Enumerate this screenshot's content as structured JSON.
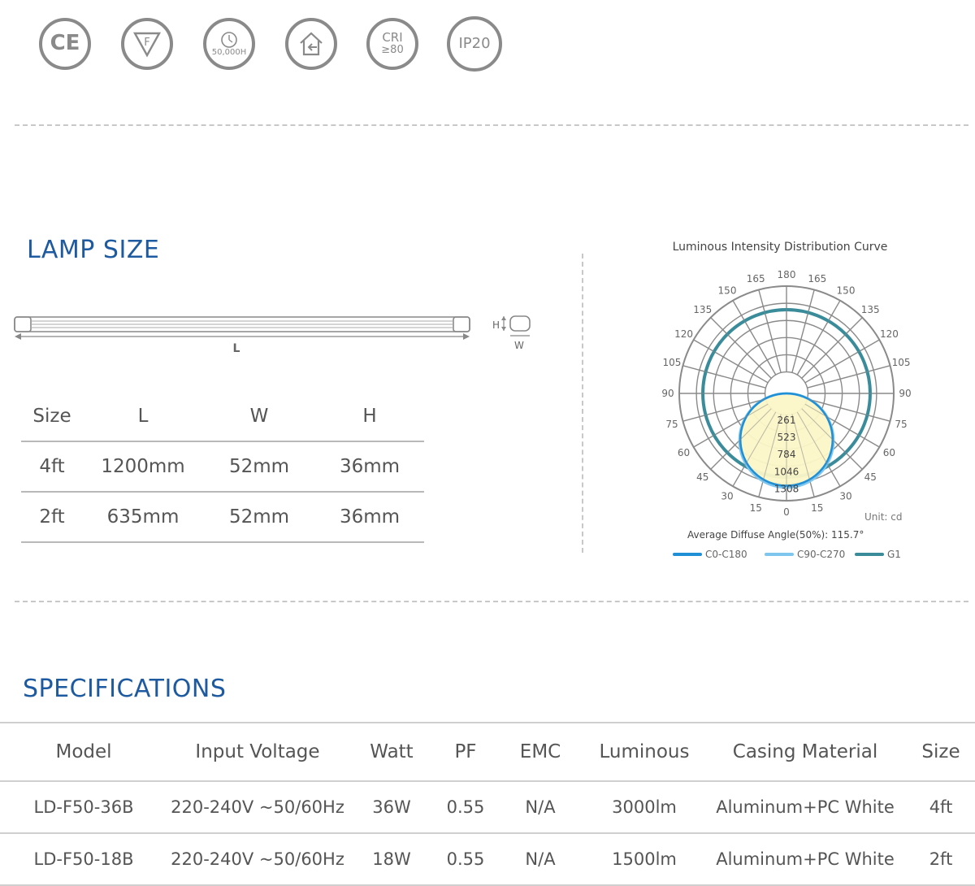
{
  "badges": [
    {
      "icon": "ce-mark-icon",
      "label": "CE"
    },
    {
      "icon": "f-mark-icon",
      "label": "F"
    },
    {
      "icon": "lifetime-clock-icon",
      "label": "50,000H"
    },
    {
      "icon": "indoor-use-icon",
      "label": ""
    },
    {
      "icon": "cri-icon",
      "label": "CRI",
      "sub": "≥80"
    },
    {
      "icon": "ip-rating-icon",
      "label": "IP20"
    }
  ],
  "lamp_size": {
    "title": "LAMP SIZE",
    "dim_labels": {
      "length": "L",
      "height": "H",
      "width": "W"
    },
    "headers": [
      "Size",
      "L",
      "W",
      "H"
    ],
    "rows": [
      [
        "4ft",
        "1200mm",
        "52mm",
        "36mm"
      ],
      [
        "2ft",
        "635mm",
        "52mm",
        "36mm"
      ]
    ]
  },
  "chart_data": {
    "type": "polar",
    "title": "Luminous Intensity Distribution Curve",
    "unit": "Unit: cd",
    "note": "Average Diffuse Angle(50%): 115.7°",
    "angle_labels": [
      "180",
      "165",
      "150",
      "135",
      "120",
      "105",
      "90",
      "75",
      "60",
      "45",
      "30",
      "15",
      "0"
    ],
    "radial_ticks": [
      261,
      523,
      784,
      1046,
      1308
    ],
    "rmax": 1308,
    "series": [
      {
        "name": "C0-C180",
        "color": "#1f8fd6"
      },
      {
        "name": "C90-C270",
        "color": "#7ec6ee"
      },
      {
        "name": "G1",
        "color": "#3b8c9a"
      }
    ],
    "fill_color": "#fbf7c7"
  },
  "specifications": {
    "title": "SPECIFICATIONS",
    "headers": [
      "Model",
      "Input Voltage",
      "Watt",
      "PF",
      "EMC",
      "Luminous",
      "Casing Material",
      "Size"
    ],
    "rows": [
      [
        "LD-F50-36B",
        "220-240V ~50/60Hz",
        "36W",
        "0.55",
        "N/A",
        "3000lm",
        "Aluminum+PC White",
        "4ft"
      ],
      [
        "LD-F50-18B",
        "220-240V ~50/60Hz",
        "18W",
        "0.55",
        "N/A",
        "1500lm",
        "Aluminum+PC White",
        "2ft"
      ]
    ]
  }
}
